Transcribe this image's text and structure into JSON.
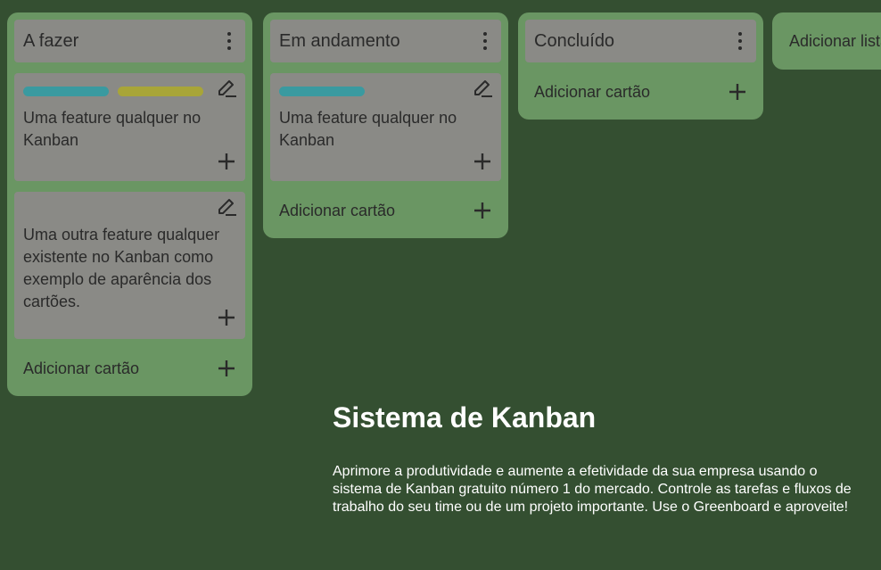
{
  "colors": {
    "background": "#344f31",
    "list": "#6a9663",
    "card": "#8a8a86",
    "label_teal": "#3a9aa0",
    "label_yellow": "#a8a538"
  },
  "icons": {
    "menu": "kebab-menu-icon",
    "edit": "pencil-icon",
    "add": "plus-icon"
  },
  "lists": [
    {
      "title": "A fazer",
      "cards": [
        {
          "labels": [
            "#3a9aa0",
            "#a8a538"
          ],
          "text": "Uma feature qualquer no Kanban"
        },
        {
          "labels": [],
          "text": "Uma outra feature qualquer existente no Kanban como exemplo de aparência dos cartões."
        }
      ],
      "add_card_label": "Adicionar cartão"
    },
    {
      "title": "Em andamento",
      "cards": [
        {
          "labels": [
            "#3a9aa0"
          ],
          "text": "Uma feature qualquer no Kanban"
        }
      ],
      "add_card_label": "Adicionar cartão"
    },
    {
      "title": "Concluído",
      "cards": [],
      "add_card_label": "Adicionar cartão"
    }
  ],
  "add_list_label": "Adicionar lista",
  "promo": {
    "title": "Sistema de Kanban",
    "text": "Aprimore a produtividade e aumente a efetividade da sua empresa usando o sistema de Kanban gratuito número 1 do mercado. Controle as tarefas e fluxos de trabalho do seu time ou de um projeto importante. Use o Greenboard e aproveite!"
  }
}
